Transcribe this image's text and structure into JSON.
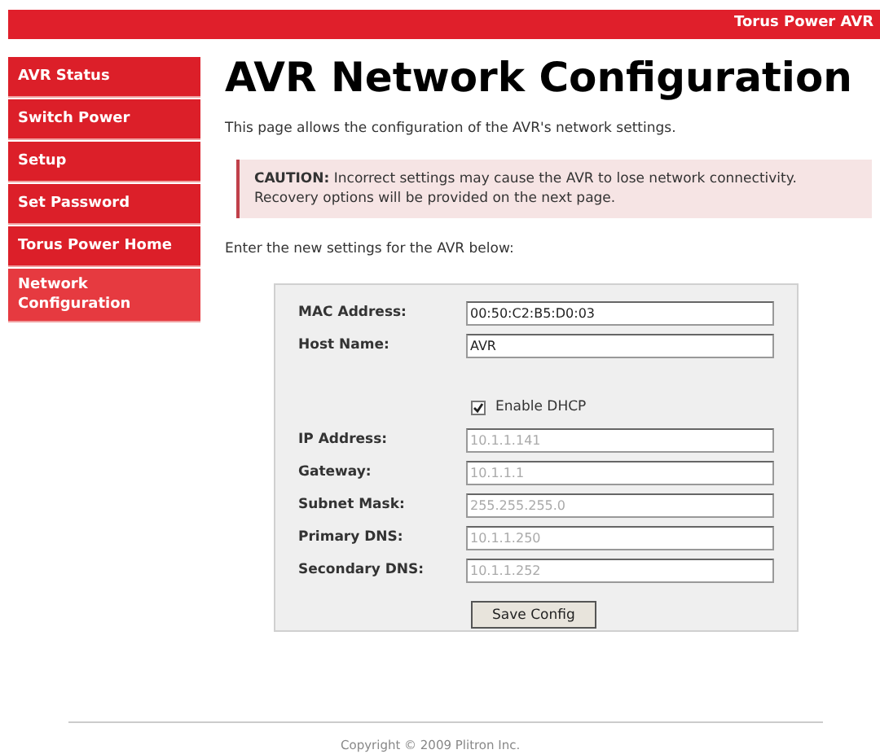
{
  "header": {
    "title": "Torus Power AVR"
  },
  "sidebar": {
    "items": [
      {
        "label": "AVR Status",
        "selected": false
      },
      {
        "label": "Switch Power",
        "selected": false
      },
      {
        "label": "Setup",
        "selected": false
      },
      {
        "label": "Set Password",
        "selected": false
      },
      {
        "label": "Torus Power Home",
        "selected": false
      },
      {
        "label": "Network Configuration",
        "selected": true
      }
    ]
  },
  "page_title": "AVR Network Configuration",
  "intro": "This page allows the configuration of the AVR's network settings.",
  "caution": "**CAUTION:** Incorrect settings may cause the AVR to lose network connectivity. Recovery options will be provided on the next page.",
  "instructions": "Enter the new settings for the AVR below:",
  "form": {
    "rows": [
      {
        "kind": "field",
        "label": "MAC Address:",
        "value": "00:50:C2:B5:D0:03",
        "disabled": false
      },
      {
        "kind": "field",
        "label": "Host Name:",
        "value": "AVR",
        "disabled": false
      },
      {
        "kind": "checkbox",
        "label": "Enable DHCP",
        "checked": true
      },
      {
        "kind": "field",
        "label": "IP Address:",
        "value": "10.1.1.141",
        "disabled": true
      },
      {
        "kind": "field",
        "label": "Gateway:",
        "value": "10.1.1.1",
        "disabled": true
      },
      {
        "kind": "field",
        "label": "Subnet Mask:",
        "value": "255.255.255.0",
        "disabled": true
      },
      {
        "kind": "field",
        "label": "Primary DNS:",
        "value": "10.1.1.250",
        "disabled": true
      },
      {
        "kind": "field",
        "label": "Secondary DNS:",
        "value": "10.1.1.252",
        "disabled": true
      }
    ],
    "button": "Save Config"
  },
  "footer": "Copyright © 2009 Plitron Inc."
}
